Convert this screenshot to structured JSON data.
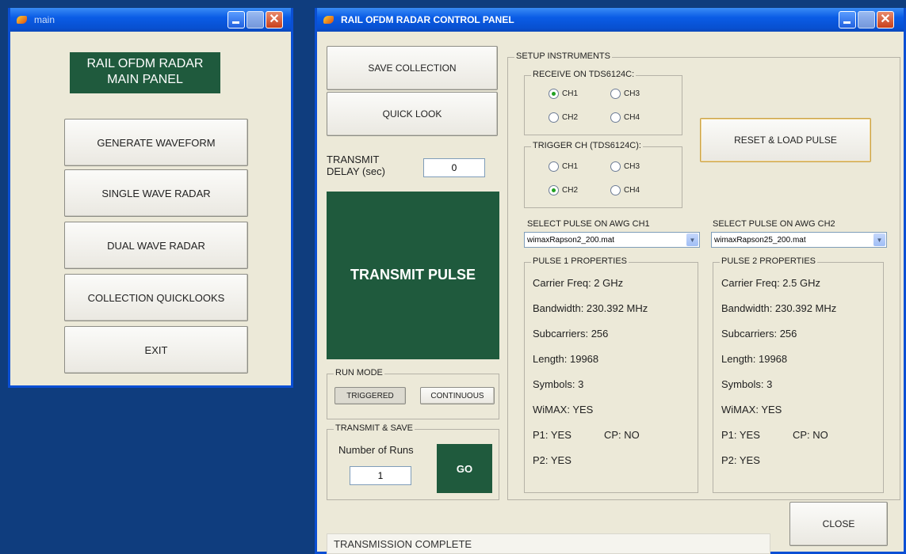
{
  "main_window": {
    "title": "main",
    "heading": "RAIL OFDM RADAR MAIN PANEL",
    "buttons": [
      "GENERATE WAVEFORM",
      "SINGLE WAVE RADAR",
      "DUAL WAVE RADAR",
      "COLLECTION QUICKLOOKS",
      "EXIT"
    ]
  },
  "control_window": {
    "title": "RAIL OFDM RADAR CONTROL PANEL",
    "save_collection": "SAVE COLLECTION",
    "quick_look": "QUICK LOOK",
    "transmit_delay_label": "TRANSMIT DELAY (sec)",
    "transmit_delay_value": "0",
    "transmit_pulse": "TRANSMIT PULSE",
    "run_mode": {
      "label": "RUN MODE",
      "triggered": "TRIGGERED",
      "continuous": "CONTINUOUS"
    },
    "transmit_save": {
      "label": "TRANSMIT & SAVE",
      "runs_label": "Number of Runs",
      "runs_value": "1",
      "go": "GO"
    },
    "setup_instruments": "SETUP INSTRUMENTS",
    "receive": {
      "label": "RECEIVE ON TDS6124C:",
      "ch1": "CH1",
      "ch2": "CH2",
      "ch3": "CH3",
      "ch4": "CH4",
      "selected": "CH1"
    },
    "trigger": {
      "label": "TRIGGER CH (TDS6124C):",
      "ch1": "CH1",
      "ch2": "CH2",
      "ch3": "CH3",
      "ch4": "CH4",
      "selected": "CH2"
    },
    "reset_load": "RESET & LOAD PULSE",
    "awg1": {
      "label": "SELECT PULSE ON AWG CH1",
      "value": "wimaxRapson2_200.mat"
    },
    "awg2": {
      "label": "SELECT PULSE ON AWG CH2",
      "value": "wimaxRapson25_200.mat"
    },
    "pulse1": {
      "label": "PULSE 1 PROPERTIES",
      "carrier": "Carrier Freq: 2 GHz",
      "bandwidth": "Bandwidth: 230.392 MHz",
      "subcarriers": "Subcarriers: 256",
      "length": "Length: 19968",
      "symbols": "Symbols: 3",
      "wimax": "WiMAX: YES",
      "p1": "P1: YES",
      "cp": "CP: NO",
      "p2": "P2: YES"
    },
    "pulse2": {
      "label": "PULSE 2 PROPERTIES",
      "carrier": "Carrier Freq: 2.5 GHz",
      "bandwidth": "Bandwidth: 230.392 MHz",
      "subcarriers": "Subcarriers: 256",
      "length": "Length: 19968",
      "symbols": "Symbols: 3",
      "wimax": "WiMAX: YES",
      "p1": "P1: YES",
      "cp": "CP: NO",
      "p2": "P2: YES"
    },
    "status": "TRANSMISSION COMPLETE",
    "close": "CLOSE"
  },
  "colors": {
    "panel_green": "#1f5a3d",
    "desktop": "#0f3d7e",
    "window_bg": "#ece9d8"
  }
}
